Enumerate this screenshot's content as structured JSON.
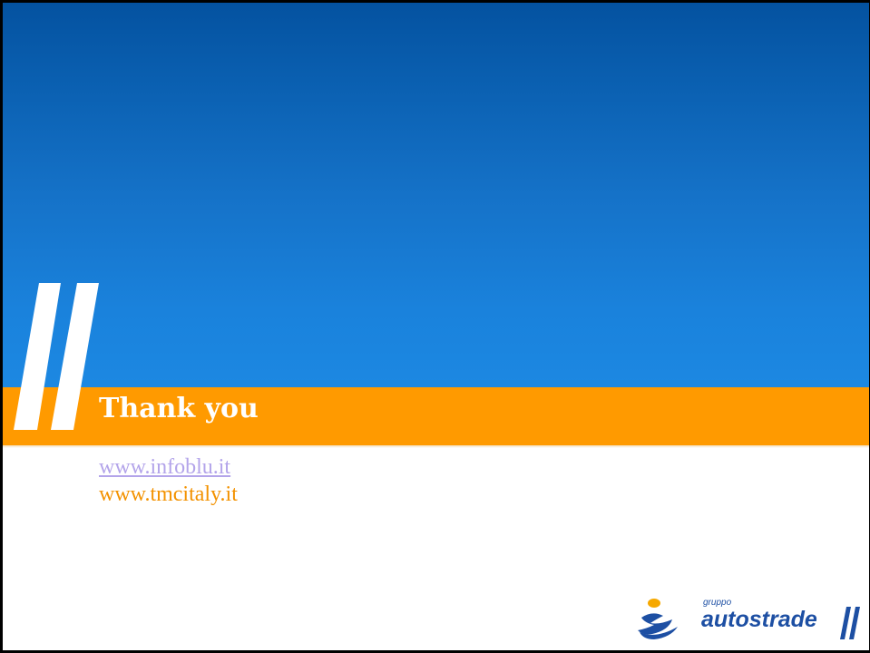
{
  "slide": {
    "title": "Thank you",
    "links": {
      "infoblu": "www.infoblu.it",
      "tmcitaly": "www.tmcitaly.it"
    }
  },
  "logo": {
    "group_label": "gruppo",
    "brand": "autostrade"
  },
  "colors": {
    "sky_top": "#0452a0",
    "sky_bottom": "#1c88e2",
    "band": "#ff9a00",
    "link_visited": "#b3a4ea",
    "link_orange": "#f39200",
    "brand_blue": "#1d4fa3"
  },
  "icons": {
    "slash_marks": "double-slash-icon",
    "brand_mark": "autostrade-runner-icon"
  }
}
